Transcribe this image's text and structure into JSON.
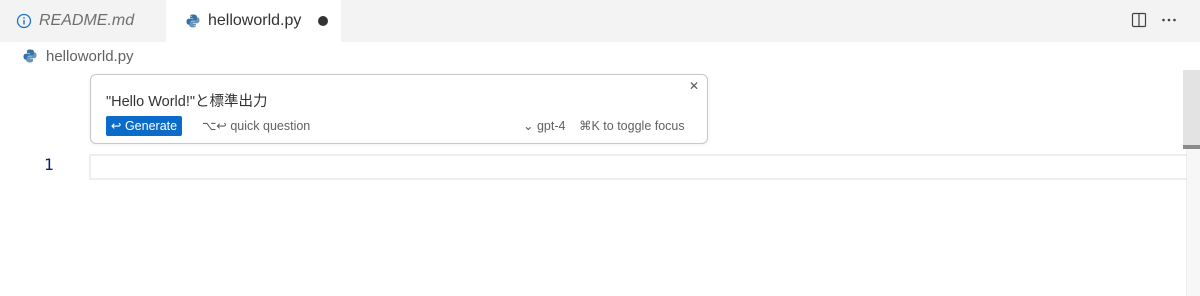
{
  "tabs": [
    {
      "label": "README.md",
      "icon": "info-icon",
      "active": false
    },
    {
      "label": "helloworld.py",
      "icon": "python-icon",
      "active": true,
      "modified": true
    }
  ],
  "breadcrumb": {
    "file": "helloworld.py",
    "icon": "python-icon"
  },
  "inline_chat": {
    "prompt": "\"Hello World!\"と標準出力",
    "generate_label": "↩ Generate",
    "quick_question": "⌥↩ quick question",
    "model": "⌄ gpt-4",
    "toggle_focus": "⌘K to toggle focus",
    "close_icon": "close-icon"
  },
  "editor": {
    "line_numbers": [
      "1"
    ]
  },
  "colors": {
    "accent": "#0a6bc9",
    "line_number": "#0b216f",
    "tab_bar": "#f3f3f3"
  }
}
